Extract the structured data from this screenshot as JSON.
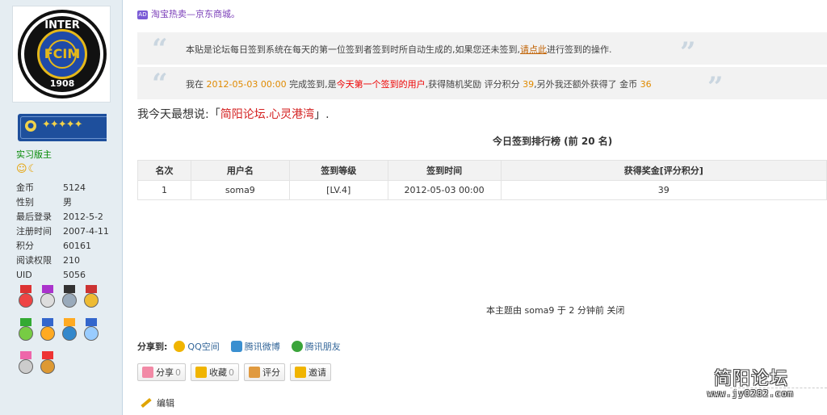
{
  "sidebar": {
    "logo": {
      "top_text": "INTER",
      "bottom_text": "1908",
      "monogram": "FCIM"
    },
    "rank_badge": {
      "dot": "●"
    },
    "role": "实习版主",
    "mood_icons": "☺☾",
    "profile": [
      {
        "label": "金币",
        "value": "5124"
      },
      {
        "label": "性别",
        "value": "男"
      },
      {
        "label": "最后登录",
        "value": "2012-5-2"
      },
      {
        "label": "注册时间",
        "value": "2007-4-11"
      },
      {
        "label": "积分",
        "value": "60161"
      },
      {
        "label": "阅读权限",
        "value": "210"
      },
      {
        "label": "UID",
        "value": "5056"
      }
    ]
  },
  "ad": {
    "icon": "AD",
    "text": "淘宝热卖—京东商城。"
  },
  "notice1": {
    "text_a": "本贴是论坛每日签到系统在每天的第一位签到者签到时所自动生成的,如果您还未签到,",
    "link": "请点此",
    "text_b": "进行签到的操作."
  },
  "notice2": {
    "t1": "我在 ",
    "time": "2012-05-03 00:00",
    "t2": " 完成签到,是",
    "first": "今天第一个签到的用户",
    "t3": ",获得随机奖励 评分积分 ",
    "pts": "39",
    "t4": ",另外我还额外获得了 金币 ",
    "coins": "36"
  },
  "today": {
    "prefix": "我今天最想说:「",
    "link": "简阳论坛.心灵港湾",
    "suffix": "」."
  },
  "ranking": {
    "title": "今日签到排行榜 (前 20 名)",
    "headers": [
      "名次",
      "用户名",
      "签到等级",
      "签到时间",
      "获得奖金[评分积分]"
    ],
    "rows": [
      [
        "1",
        "soma9",
        "[LV.4]",
        "2012-05-03 00:00",
        "39"
      ]
    ]
  },
  "closed_note": "本主题由 soma9 于 2 分钟前 关闭",
  "share": {
    "label": "分享到:",
    "items": [
      {
        "label": "QQ空间",
        "color": "#f0b400"
      },
      {
        "label": "腾讯微博",
        "color": "#3a8fd0"
      },
      {
        "label": "腾讯朋友",
        "color": "#3aa43a"
      }
    ]
  },
  "actions": [
    {
      "label": "分享",
      "count": "0",
      "color": "#f28aa6"
    },
    {
      "label": "收藏",
      "count": "0",
      "color": "#f0b400"
    },
    {
      "label": "评分",
      "count": "",
      "color": "#e09a40"
    },
    {
      "label": "邀请",
      "count": "",
      "color": "#f0b400"
    }
  ],
  "edit_label": "编辑",
  "watermark": {
    "title": "简阳论坛",
    "url": "www.jy0282.com"
  },
  "colors": {
    "accent_link": "#336699",
    "highlight": "#e08a00",
    "red": "#e00",
    "sidebar_bg": "#e5edf2"
  }
}
